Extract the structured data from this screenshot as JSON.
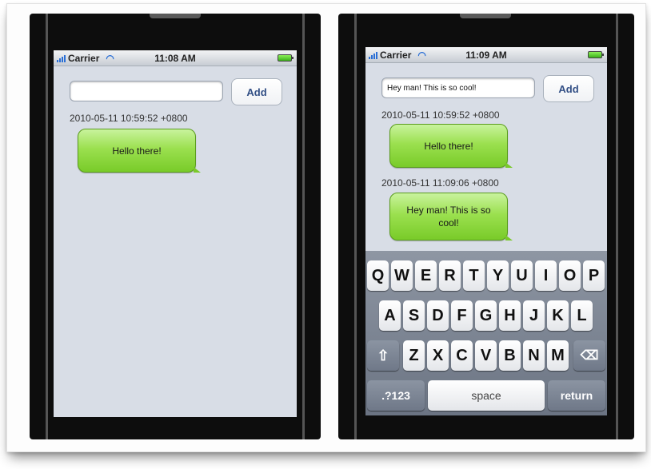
{
  "left_phone": {
    "status": {
      "carrier": "Carrier",
      "time": "11:08 AM"
    },
    "input_value": "",
    "add_label": "Add",
    "messages": [
      {
        "timestamp": "2010-05-11 10:59:52 +0800",
        "text": "Hello there!"
      }
    ]
  },
  "right_phone": {
    "status": {
      "carrier": "Carrier",
      "time": "11:09 AM"
    },
    "input_value": "Hey man! This is so cool!",
    "add_label": "Add",
    "messages": [
      {
        "timestamp": "2010-05-11 10:59:52 +0800",
        "text": "Hello there!"
      },
      {
        "timestamp": "2010-05-11 11:09:06 +0800",
        "text": "Hey man! This is so cool!"
      }
    ],
    "keyboard": {
      "row1": [
        "Q",
        "W",
        "E",
        "R",
        "T",
        "Y",
        "U",
        "I",
        "O",
        "P"
      ],
      "row2": [
        "A",
        "S",
        "D",
        "F",
        "G",
        "H",
        "J",
        "K",
        "L"
      ],
      "row3": [
        "Z",
        "X",
        "C",
        "V",
        "B",
        "N",
        "M"
      ],
      "shift_icon": "shift-icon",
      "delete_icon": "delete-icon",
      "numbers_label": ".?123",
      "space_label": "space",
      "return_label": "return"
    }
  },
  "colors": {
    "bubble_green": "#9be04f",
    "screen_bg": "#d8dde6",
    "add_text": "#324f85"
  }
}
